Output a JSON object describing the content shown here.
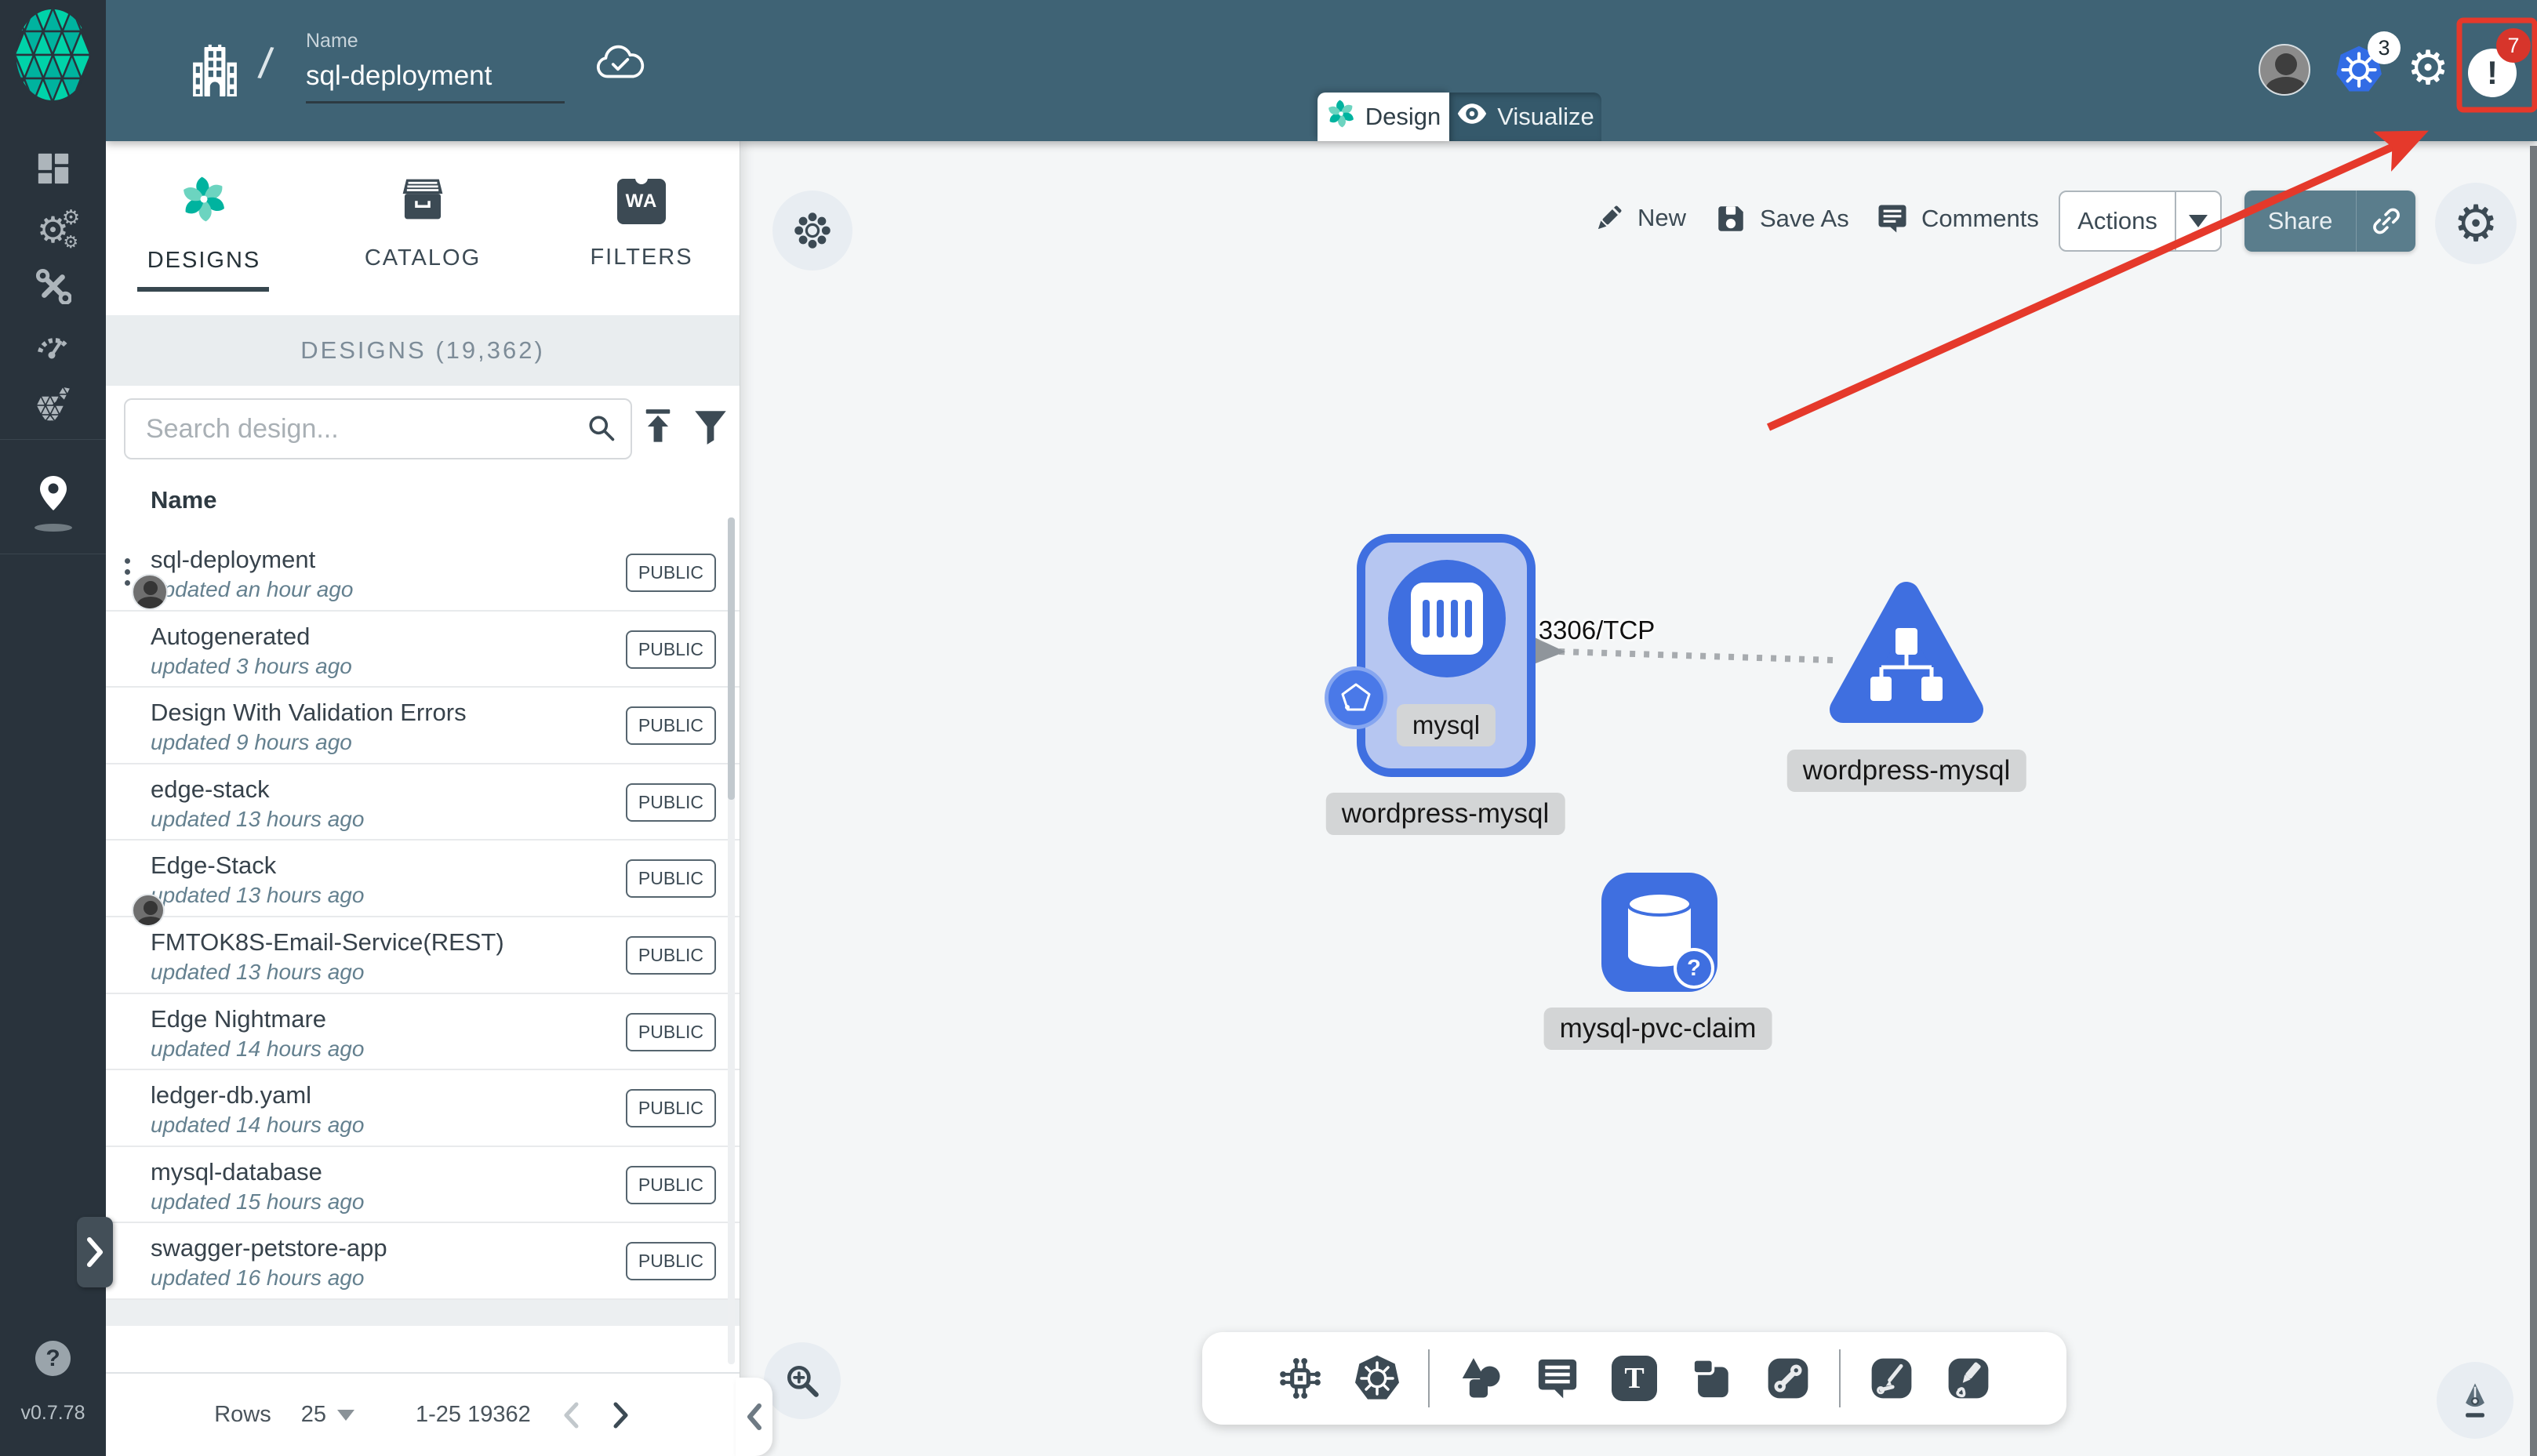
{
  "app": {
    "version": "v0.7.78"
  },
  "topbar": {
    "name_label": "Name",
    "name_value": "sql-deployment",
    "breadcrumb_slash": "/",
    "kubernetes_badge": "3",
    "notification_count": "7",
    "notification_bang": "!"
  },
  "mode_tabs": {
    "design": "Design",
    "visualize": "Visualize"
  },
  "actions_bar": {
    "new": "New",
    "save_as": "Save As",
    "comments": "Comments",
    "actions": "Actions",
    "share": "Share"
  },
  "sidebar_icons": [
    "dashboard-icon",
    "lifecycle-gears-icon",
    "toolkit-icon",
    "performance-icon",
    "extensions-icon",
    "kanvas-pin-icon"
  ],
  "panel": {
    "tabs": [
      "DESIGNS",
      "CATALOG",
      "FILTERS"
    ],
    "filters_icon_text": "WA",
    "count_header": "DESIGNS (19,362)",
    "search_placeholder": "Search design...",
    "name_column": "Name",
    "designs": [
      {
        "name": "sql-deployment",
        "updated": "updated an hour ago",
        "badge": "PUBLIC",
        "menu": true,
        "avatar": true
      },
      {
        "name": "Autogenerated",
        "updated": "updated 3 hours ago",
        "badge": "PUBLIC"
      },
      {
        "name": "Design With Validation Errors",
        "updated": "updated 9 hours ago",
        "badge": "PUBLIC"
      },
      {
        "name": "edge-stack",
        "updated": "updated 13 hours ago",
        "badge": "PUBLIC"
      },
      {
        "name": "Edge-Stack",
        "updated": "updated 13 hours ago",
        "badge": "PUBLIC",
        "avatar_bottom": true
      },
      {
        "name": "FMTOK8S-Email-Service(REST)",
        "updated": "updated 13 hours ago",
        "badge": "PUBLIC"
      },
      {
        "name": "Edge Nightmare",
        "updated": "updated 14 hours ago",
        "badge": "PUBLIC"
      },
      {
        "name": "ledger-db.yaml",
        "updated": "updated 14 hours ago",
        "badge": "PUBLIC"
      },
      {
        "name": "mysql-database",
        "updated": "updated 15 hours ago",
        "badge": "PUBLIC"
      },
      {
        "name": "swagger-petstore-app",
        "updated": "updated 16 hours ago",
        "badge": "PUBLIC"
      }
    ],
    "pagination": {
      "rows_label": "Rows",
      "per_page": "25",
      "range": "1-25 19362"
    }
  },
  "canvas": {
    "edge_label": "3306/TCP",
    "nodes": {
      "deployment": {
        "inner_label": "mysql",
        "label": "wordpress-mysql"
      },
      "service": {
        "label": "wordpress-mysql"
      },
      "pvc": {
        "label": "mysql-pvc-claim"
      }
    },
    "toolbar_icons": [
      "circuit-component-icon",
      "kubernetes-icon",
      "shapes-icon",
      "comment-tool-icon",
      "text-tool-icon",
      "note-tool-icon",
      "link-tool-icon",
      "pen-arrow-tool-icon",
      "freehand-pencil-icon"
    ]
  },
  "colors": {
    "accent_green": "#00B39F",
    "header_teal": "#3F6375",
    "sidebar_dark": "#29333C",
    "node_blue": "#3F6FE0",
    "kubernetes_blue": "#326CE5",
    "annotation_red": "#E5392B",
    "badge_red": "#D7352B"
  }
}
